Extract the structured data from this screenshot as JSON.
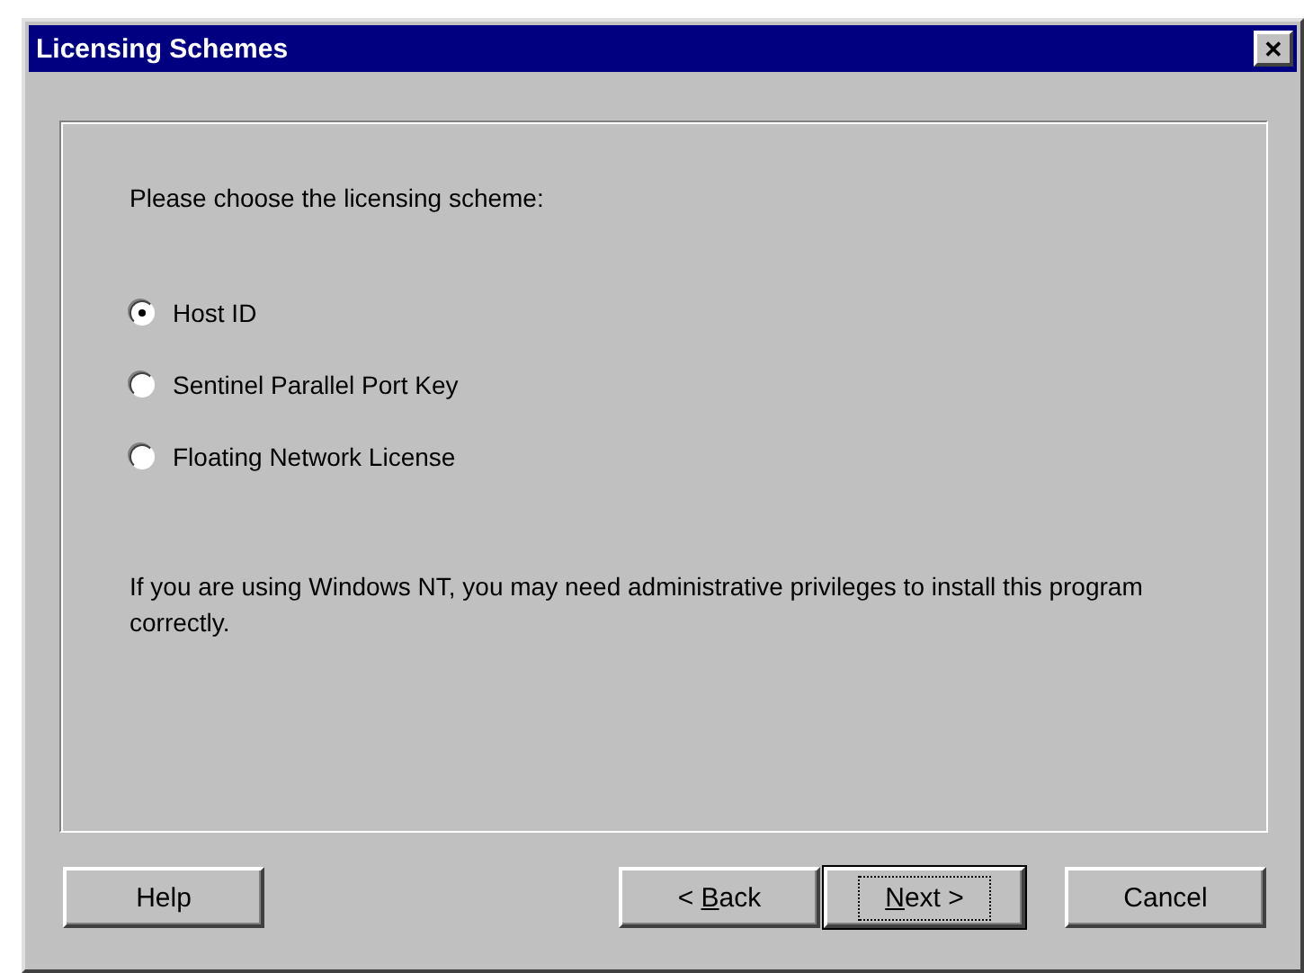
{
  "window": {
    "title": "Licensing Schemes",
    "close": "✕"
  },
  "prompt": "Please choose the licensing scheme:",
  "options": [
    {
      "label": "Host ID",
      "selected": true
    },
    {
      "label": "Sentinel Parallel Port Key",
      "selected": false
    },
    {
      "label": "Floating Network License",
      "selected": false
    }
  ],
  "note": "If you are using Windows NT, you may need administrative privileges to install this program correctly.",
  "buttons": [
    {
      "label": "Help",
      "default": false
    },
    {
      "label_before": "< ",
      "mnemonic": "B",
      "label_after": "ack",
      "default": false
    },
    {
      "mnemonic": "N",
      "label_after": "ext >",
      "default": true
    },
    {
      "label": "Cancel",
      "default": false
    }
  ]
}
